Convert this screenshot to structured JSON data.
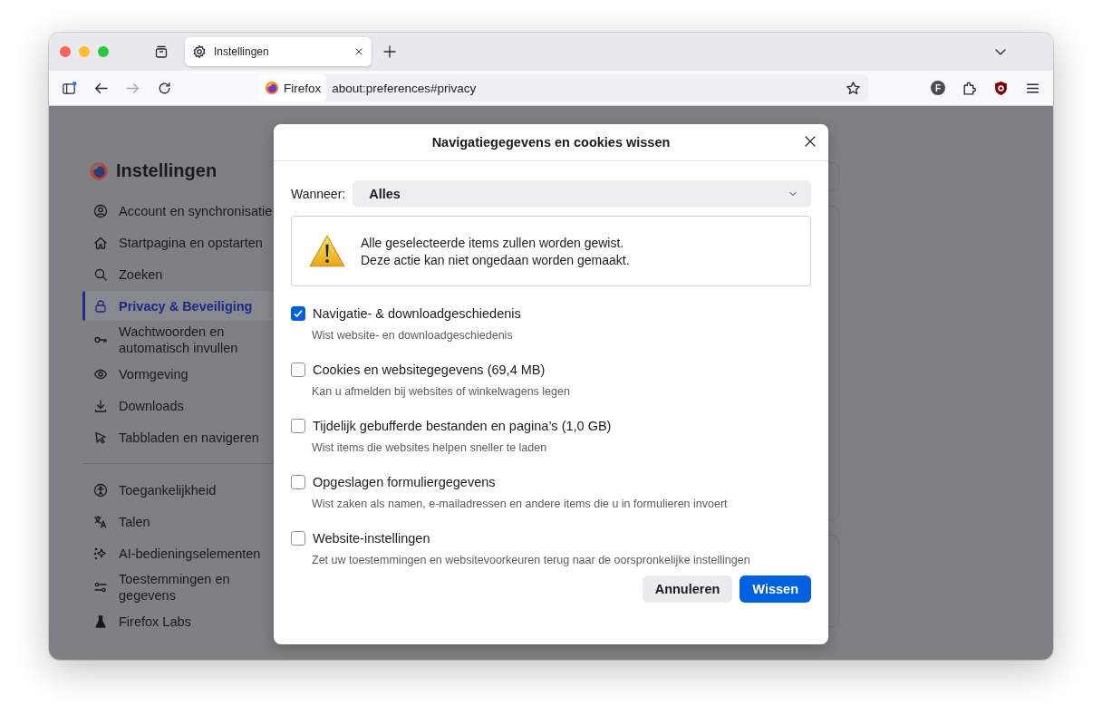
{
  "tabs": [
    {
      "label": "Instellingen",
      "selected": true
    }
  ],
  "toolbar": {
    "forward_disabled": true,
    "identity": "Firefox",
    "url": "about:preferences#privacy",
    "account_initial": "F"
  },
  "sidebar": {
    "title": "Instellingen",
    "groups": [
      [
        {
          "label": "Account en synchronisatie",
          "selected": false
        },
        {
          "label": "Startpagina en opstarten",
          "selected": false
        },
        {
          "label": "Zoeken",
          "selected": false
        },
        {
          "label": "Privacy & Beveiliging",
          "selected": true
        },
        {
          "label": "Wachtwoorden en automatisch invullen",
          "selected": false
        },
        {
          "label": "Vormgeving",
          "selected": false
        },
        {
          "label": "Downloads",
          "selected": false
        },
        {
          "label": "Tabbladen en navigeren",
          "selected": false
        }
      ],
      [
        {
          "label": "Toegankelijkheid",
          "selected": false
        },
        {
          "label": "Talen",
          "selected": false
        },
        {
          "label": "AI-bedieningselementen",
          "selected": false
        },
        {
          "label": "Toestemmingen en gegevens",
          "selected": false
        },
        {
          "label": "Firefox Labs",
          "selected": false
        }
      ]
    ]
  },
  "dialog": {
    "title": "Navigatiegegevens en cookies wissen",
    "when_label": "Wanneer:",
    "when_value": "Alles",
    "warning": [
      "Alle geselecteerde items zullen worden gewist.",
      "Deze actie kan niet ongedaan worden gemaakt."
    ],
    "options": [
      {
        "label": "Navigatie- & downloadgeschiedenis",
        "description": "Wist website- en downloadgeschiedenis",
        "checked": true
      },
      {
        "label": "Cookies en websitegegevens (69,4 MB)",
        "description": "Kan u afmelden bij websites of winkelwagens legen",
        "checked": false
      },
      {
        "label": "Tijdelijk gebufferde bestanden en pagina’s (1,0 GB)",
        "description": "Wist items die websites helpen sneller te laden",
        "checked": false
      },
      {
        "label": "Opgeslagen formuliergegevens",
        "description": "Wist zaken als namen, e-mailadressen en andere items die u in formulieren invoert",
        "checked": false
      },
      {
        "label": "Website-instellingen",
        "description": "Zet uw toestemmingen en websitevoorkeuren terug naar de oorspronkelijke instellingen",
        "checked": false
      }
    ],
    "buttons": [
      {
        "label": "Annuleren",
        "kind": "secondary"
      },
      {
        "label": "Wissen",
        "kind": "primary"
      }
    ]
  }
}
